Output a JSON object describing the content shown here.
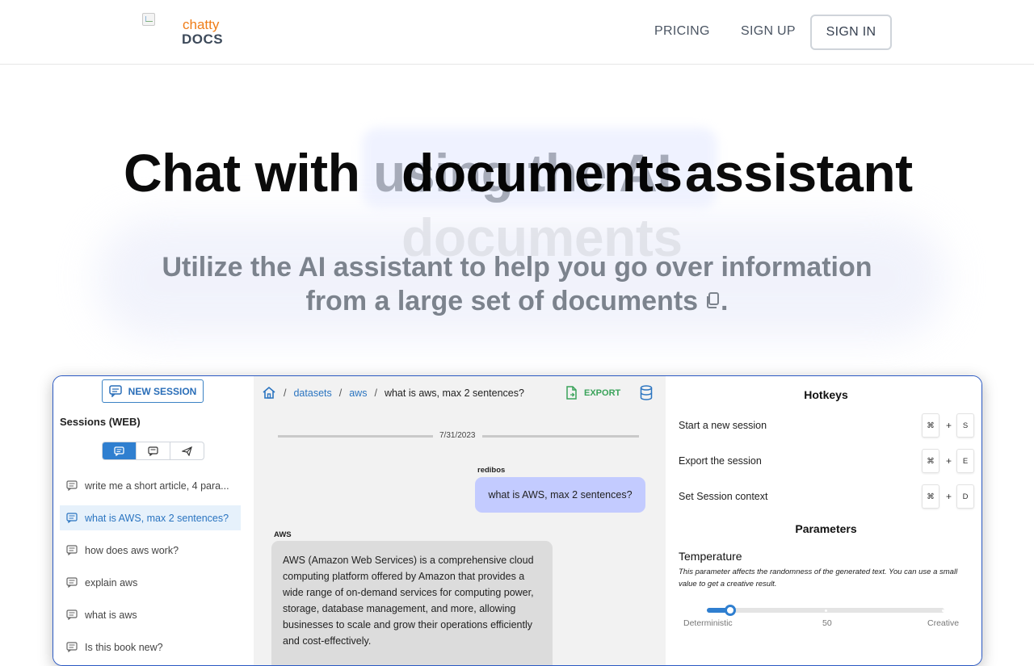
{
  "nav": {
    "logo_top": "chatty",
    "logo_bottom": "DOCS",
    "pricing": "PRICING",
    "sign_up": "SIGN UP",
    "sign_in": "SIGN IN"
  },
  "hero": {
    "title_prefix": "Chat with",
    "title_ghost": "using the AI",
    "title_main": "documents",
    "title_suffix": "assistant",
    "title_ghost_below": "documents",
    "subtitle_line1": "Utilize the AI assistant to help you go over information",
    "subtitle_line2": "from a large set of documents",
    "subtitle_end": "."
  },
  "app": {
    "sidebar": {
      "new_session": "NEW SESSION",
      "sessions_label": "Sessions (WEB)",
      "sessions": [
        {
          "label": "write me a short article, 4 para..."
        },
        {
          "label": "what is AWS, max 2 sentences?"
        },
        {
          "label": "how does aws work?"
        },
        {
          "label": "explain aws"
        },
        {
          "label": "what is aws"
        },
        {
          "label": "Is this book new?"
        }
      ]
    },
    "chat": {
      "breadcrumb": [
        "datasets",
        "aws",
        "what is aws, max 2 sentences?"
      ],
      "export": "EXPORT",
      "date": "7/31/2023",
      "user_name": "redibos",
      "user_message": "what is AWS, max 2 sentences?",
      "ai_name": "AWS",
      "ai_message": "AWS (Amazon Web Services) is a comprehensive cloud computing platform offered by Amazon that provides a wide range of on-demand services for computing power, storage, database management, and more, allowing businesses to scale and grow their operations efficiently and cost-effectively."
    },
    "panel": {
      "hotkeys_title": "Hotkeys",
      "hotkeys": [
        {
          "label": "Start a new session",
          "mod": "⌘",
          "key": "S"
        },
        {
          "label": "Export the session",
          "mod": "⌘",
          "key": "E"
        },
        {
          "label": "Set Session context",
          "mod": "⌘",
          "key": "D"
        }
      ],
      "plus": "+",
      "parameters_title": "Parameters",
      "temperature_label": "Temperature",
      "temperature_desc": "This parameter affects the randomness of the generated text. You can use a small value to get a creative result.",
      "slider": {
        "min_label": "Deterministic",
        "mid_label": "50",
        "max_label": "Creative",
        "value_fraction": 0.1
      }
    }
  },
  "colors": {
    "accent": "#2f7fd0",
    "logo_orange": "#ef7d18",
    "export_green": "#3aa35a",
    "user_bubble": "#c3cbff"
  }
}
